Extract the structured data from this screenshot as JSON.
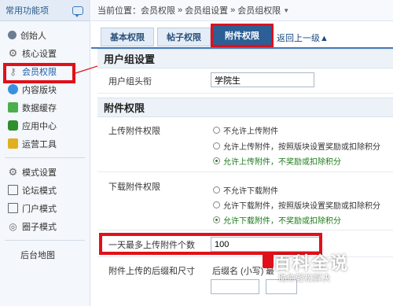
{
  "sidebar": {
    "title": "常用功能项",
    "items": [
      {
        "label": "创始人",
        "icon": "person-icon"
      },
      {
        "label": "核心设置",
        "icon": "gear-icon"
      },
      {
        "label": "会员权限",
        "icon": "key-icon"
      },
      {
        "label": "内容版块",
        "icon": "chat-bubble-icon"
      },
      {
        "label": "数据缓存",
        "icon": "database-icon"
      },
      {
        "label": "应用中心",
        "icon": "app-center-icon"
      },
      {
        "label": "运营工具",
        "icon": "tool-icon"
      },
      {
        "label": "模式设置",
        "icon": "grid-icon"
      },
      {
        "label": "论坛模式",
        "icon": "forum-icon"
      },
      {
        "label": "门户模式",
        "icon": "portal-icon"
      },
      {
        "label": "圈子模式",
        "icon": "globe-icon"
      },
      {
        "label": "后台地图",
        "icon": ""
      }
    ]
  },
  "breadcrumb": {
    "prefix": "当前位置：",
    "parts": [
      "会员权限",
      "会员组设置",
      "会员组权限"
    ],
    "separator": "»"
  },
  "tabs": {
    "basic": "基本权限",
    "post": "帖子权限",
    "attachment": "附件权限",
    "back": "返回上一级▲"
  },
  "group_settings": {
    "section_title": "用户组设置",
    "title_label": "用户组头衔",
    "title_value": "学院生"
  },
  "attachment": {
    "section_title": "附件权限",
    "upload_label": "上传附件权限",
    "upload_options": [
      "不允许上传附件",
      "允许上传附件，按照版块设置奖励或扣除积分",
      "允许上传附件，不奖励或扣除积分"
    ],
    "download_label": "下载附件权限",
    "download_options": [
      "不允许下载附件",
      "允许下载附件，按照版块设置奖励或扣除积分",
      "允许下载附件，不奖励或扣除积分"
    ],
    "daily_max_label": "一天最多上传附件个数",
    "daily_max_value": "100",
    "ext_label": "附件上传的后缀和尺寸",
    "ext_col1": "后缀名 (小写)",
    "ext_col2": "最"
  },
  "watermark": {
    "title": "百科全说",
    "subtitle": "助你轻松解决"
  },
  "colors": {
    "highlight": "#e0101a",
    "tab_active": "#2b5f95",
    "checked_text": "#1a7a1a"
  }
}
